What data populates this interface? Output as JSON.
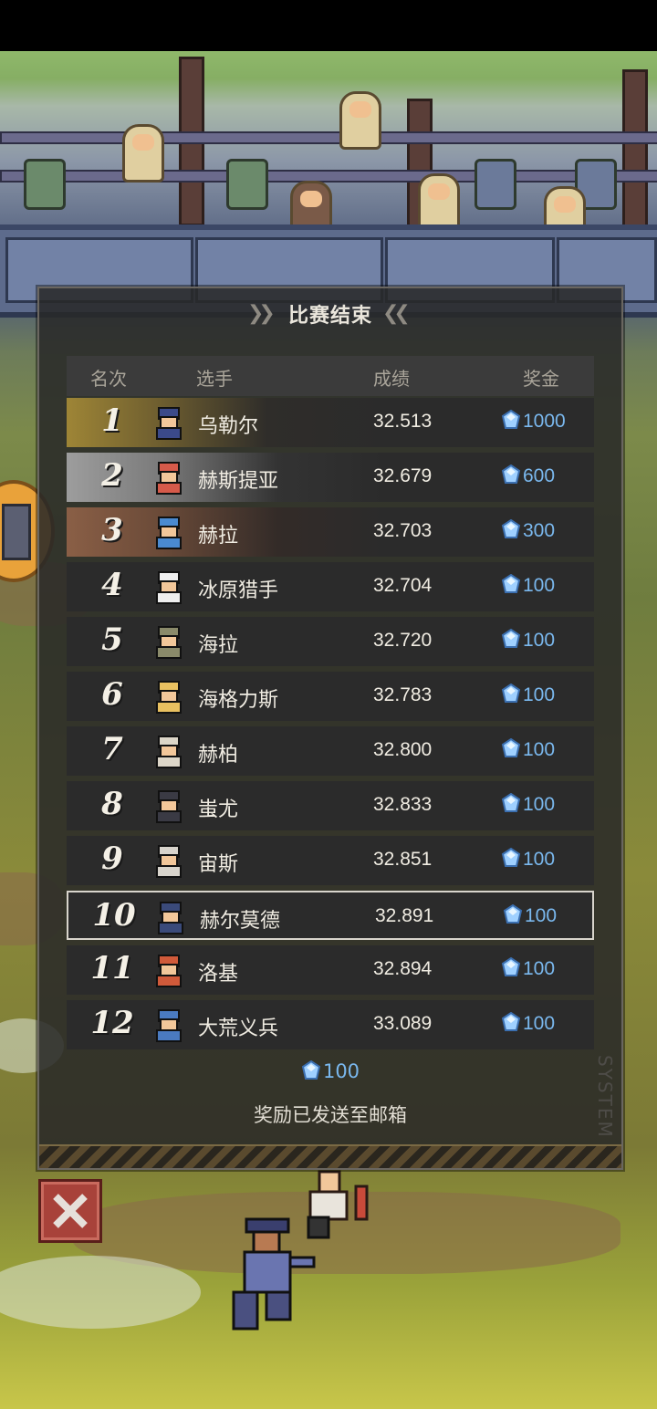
{
  "panel": {
    "title": "比赛结束",
    "headers": {
      "rank": "名次",
      "player": "选手",
      "score": "成绩",
      "prize": "奖金"
    },
    "rows": [
      {
        "rank": "1",
        "name": "乌勒尔",
        "score": "32.513",
        "prize": "1000",
        "tier": "gold",
        "avatar": "blue-hat-icon"
      },
      {
        "rank": "2",
        "name": "赫斯提亚",
        "score": "32.679",
        "prize": "600",
        "tier": "silver",
        "avatar": "chef-red-hair-icon"
      },
      {
        "rank": "3",
        "name": "赫拉",
        "score": "32.703",
        "prize": "300",
        "tier": "bronze",
        "avatar": "blue-hair-icon"
      },
      {
        "rank": "4",
        "name": "冰原猎手",
        "score": "32.704",
        "prize": "100",
        "tier": "",
        "avatar": "white-hair-icon"
      },
      {
        "rank": "5",
        "name": "海拉",
        "score": "32.720",
        "prize": "100",
        "tier": "",
        "avatar": "grey-hood-icon"
      },
      {
        "rank": "6",
        "name": "海格力斯",
        "score": "32.783",
        "prize": "100",
        "tier": "",
        "avatar": "blonde-icon"
      },
      {
        "rank": "7",
        "name": "赫柏",
        "score": "32.800",
        "prize": "100",
        "tier": "",
        "avatar": "pale-hair-icon"
      },
      {
        "rank": "8",
        "name": "蚩尤",
        "score": "32.833",
        "prize": "100",
        "tier": "",
        "avatar": "dark-mask-icon"
      },
      {
        "rank": "9",
        "name": "宙斯",
        "score": "32.851",
        "prize": "100",
        "tier": "",
        "avatar": "old-man-icon"
      },
      {
        "rank": "10",
        "name": "赫尔莫德",
        "score": "32.891",
        "prize": "100",
        "tier": "self",
        "avatar": "helmet-icon"
      },
      {
        "rank": "11",
        "name": "洛基",
        "score": "32.894",
        "prize": "100",
        "tier": "",
        "avatar": "red-hair-icon"
      },
      {
        "rank": "12",
        "name": "大荒义兵",
        "score": "33.089",
        "prize": "100",
        "tier": "",
        "avatar": "blue-cap-icon"
      }
    ],
    "total_reward": "100",
    "mail_note": "奖励已发送至邮箱",
    "watermark": "SYSTEM"
  },
  "colors": {
    "prize": "#7ab8ee",
    "gold": "#9e8536",
    "silver": "#9d9d9d",
    "bronze": "#8a5f46"
  }
}
